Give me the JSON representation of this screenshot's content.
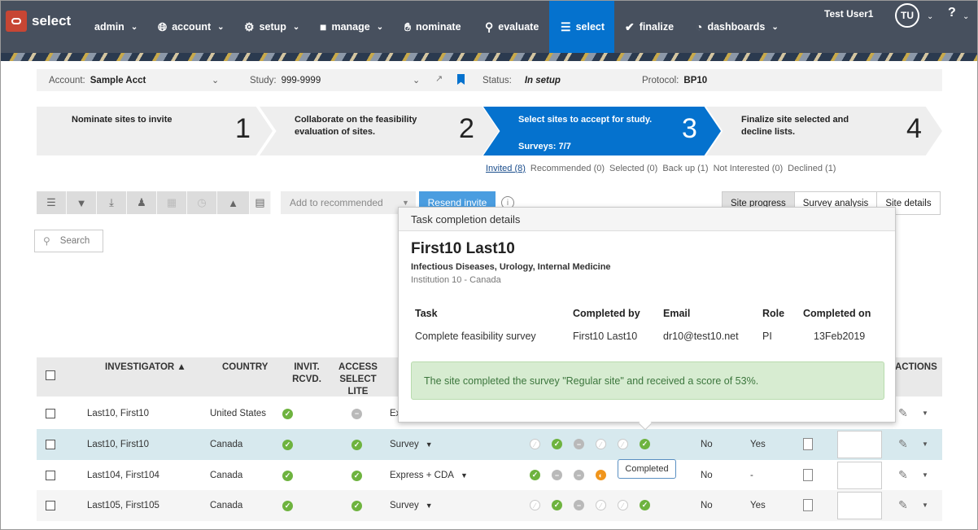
{
  "app": {
    "logo_text": "select"
  },
  "nav": {
    "items": [
      {
        "label": "admin",
        "icon": "",
        "chevron": true
      },
      {
        "label": "account",
        "icon": "globe-icon",
        "chevron": true
      },
      {
        "label": "setup",
        "icon": "gear-icon",
        "chevron": true
      },
      {
        "label": "manage",
        "icon": "person-icon",
        "chevron": true
      },
      {
        "label": "nominate",
        "icon": "hand-icon",
        "chevron": false
      },
      {
        "label": "evaluate",
        "icon": "search-icon",
        "chevron": false
      },
      {
        "label": "select",
        "icon": "list-icon",
        "chevron": false,
        "active": true
      },
      {
        "label": "finalize",
        "icon": "check-circle-icon",
        "chevron": false
      },
      {
        "label": "dashboards",
        "icon": "pie-chart-icon",
        "chevron": true
      }
    ],
    "user_name": "Test User1",
    "avatar_initials": "TU",
    "help_label": "?"
  },
  "infobar": {
    "account_label": "Account:",
    "account_value": "Sample Acct",
    "study_label": "Study:",
    "study_value": "999-9999",
    "status_label": "Status:",
    "status_value": "In setup",
    "protocol_label": "Protocol:",
    "protocol_value": "BP10"
  },
  "steps": [
    {
      "text": "Nominate sites to invite",
      "number": "1"
    },
    {
      "text": "Collaborate on the feasibility evaluation of sites.",
      "number": "2"
    },
    {
      "text": "Select sites to accept for study.",
      "number": "3",
      "sub": "Surveys: 7/7",
      "active": true
    },
    {
      "text": "Finalize site selected and decline lists.",
      "number": "4"
    }
  ],
  "subtabs": [
    "Invited (8)",
    "Recommended (0)",
    "Selected (0)",
    "Back up (1)",
    "Not Interested (0)",
    "Declined (1)"
  ],
  "toolbar": {
    "add_recommended": "Add to recommended",
    "resend_invite": "Resend invite",
    "view_tabs": [
      "Site progress",
      "Survey analysis",
      "Site details"
    ]
  },
  "search": {
    "placeholder": "Search"
  },
  "table": {
    "headers": {
      "investigator": "INVESTIGATOR",
      "country": "COUNTRY",
      "invit": "INVIT. RCVD.",
      "access": "ACCESS SELECT LITE",
      "actions": "ACTIONS"
    },
    "rows": [
      {
        "investigator": "Last10, First10",
        "country": "United States",
        "type": "Ex",
        "progress": [],
        "col_a": "",
        "col_b": ""
      },
      {
        "investigator": "Last10, First10",
        "country": "Canada",
        "type": "Survey",
        "progress": [
          "emp",
          "g",
          "gr",
          "emp",
          "emp",
          "g"
        ],
        "col_a": "No",
        "col_b": "Yes"
      },
      {
        "investigator": "Last104, First104",
        "country": "Canada",
        "type": "Express + CDA",
        "progress": [
          "g",
          "gr",
          "gr",
          "o"
        ],
        "col_a": "No",
        "col_b": "-"
      },
      {
        "investigator": "Last105, First105",
        "country": "Canada",
        "type": "Survey",
        "progress": [
          "emp",
          "g",
          "gr",
          "emp",
          "emp",
          "g"
        ],
        "col_a": "No",
        "col_b": "Yes"
      }
    ]
  },
  "popup": {
    "title": "Task completion details",
    "name": "First10 Last10",
    "specialties": "Infectious Diseases, Urology, Internal Medicine",
    "institution": "Institution 10 - Canada",
    "columns": [
      "Task",
      "Completed by",
      "Email",
      "Role",
      "Completed on"
    ],
    "row": [
      "Complete feasibility survey",
      "First10 Last10",
      "dr10@test10.net",
      "PI",
      "13Feb2019"
    ],
    "alert": "The site completed the survey \"Regular site\" and received a score of 53%."
  },
  "tooltip": {
    "text": "Completed"
  }
}
